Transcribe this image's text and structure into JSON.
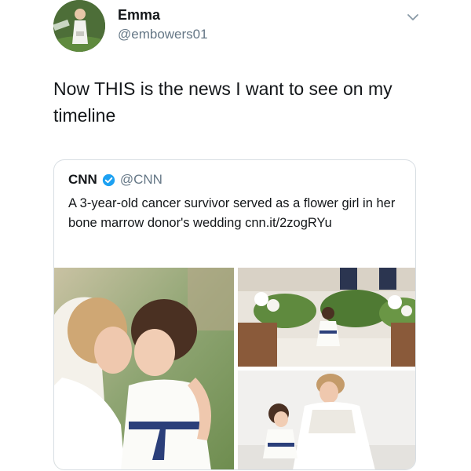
{
  "tweet": {
    "user": {
      "name": "Emma",
      "handle": "@embowers01"
    },
    "text": "Now THIS is the news I want to see on my timeline",
    "menu_icon": "chevron-down-icon"
  },
  "quoted_tweet": {
    "name": "CNN",
    "verified": true,
    "verified_icon": "verified-badge-icon",
    "handle": "@CNN",
    "text": "A 3-year-old cancer survivor served as a flower girl in her bone marrow donor's wedding cnn.it/2zogRYu",
    "photos": [
      "bride-and-flower-girl-embrace-photo",
      "flower-girl-walking-aisle-photo",
      "bride-kneeling-with-flower-girl-photo"
    ]
  },
  "colors": {
    "text_primary": "#14171a",
    "text_secondary": "#657786",
    "card_border": "#d8dee3",
    "verified_blue": "#1da1f2"
  }
}
